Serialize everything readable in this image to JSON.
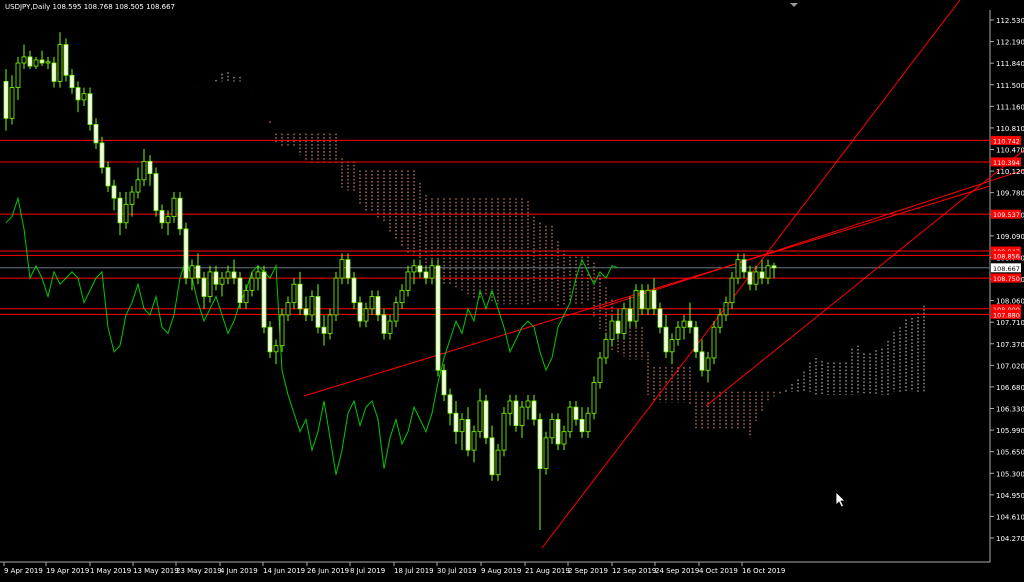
{
  "header": {
    "symbol_label": "USDJPY,Daily",
    "ohlc_label": "108.595 108.768 108.505 108.667"
  },
  "colors": {
    "background": "#000000",
    "bull_candle": "#7CFC00",
    "bear_candle": "#7CFC00",
    "candle_fill_bull": "#ffffff",
    "chikou": "#00c800",
    "kumo_bull": "#d8d8d8",
    "kumo_bear": "#ff9f80",
    "trendline": "#ff0000",
    "hline": "#ff0000",
    "axis_text": "#ffffff",
    "price_tag_bg": "#ff0000"
  },
  "chart_data": {
    "type": "candlestick",
    "title": "USDJPY,Daily",
    "ylim": [
      104.27,
      112.7
    ],
    "y_ticks": [
      "112.530",
      "112.190",
      "111.840",
      "111.500",
      "111.160",
      "110.810",
      "110.470",
      "110.120",
      "109.780",
      "109.430",
      "109.090",
      "108.740",
      "108.400",
      "108.060",
      "107.710",
      "107.370",
      "107.020",
      "106.680",
      "106.330",
      "105.990",
      "105.650",
      "105.300",
      "104.950",
      "104.610",
      "104.270"
    ],
    "x_labels": [
      "9 Apr 2019",
      "19 Apr 2019",
      "1 May 2019",
      "13 May 2019",
      "23 May 2019",
      "4 Jun 2019",
      "14 Jun 2019",
      "26 Jun 2019",
      "8 Jul 2019",
      "18 Jul 2019",
      "30 Jul 2019",
      "9 Aug 2019",
      "21 Aug 2019",
      "2 Sep 2019",
      "12 Sep 2019",
      "24 Sep 2019",
      "4 Oct 2019",
      "16 Oct 2019"
    ],
    "current_price": "108.667",
    "price_tags": [
      {
        "value": 110.74,
        "label": "110.742"
      },
      {
        "value": 110.39,
        "label": "110.394"
      },
      {
        "value": 109.54,
        "label": "109.537"
      },
      {
        "value": 108.94,
        "label": "108.947"
      },
      {
        "value": 108.87,
        "label": "108.856"
      },
      {
        "value": 108.5,
        "label": "108.750"
      },
      {
        "value": 108.0,
        "label": "108.000"
      },
      {
        "value": 107.91,
        "label": "107.880"
      }
    ],
    "ohlc": [
      [
        111.7,
        111.9,
        110.9,
        111.1
      ],
      [
        111.1,
        111.8,
        111.0,
        111.6
      ],
      [
        111.6,
        112.1,
        111.4,
        112.0
      ],
      [
        112.0,
        112.3,
        111.9,
        112.1
      ],
      [
        112.1,
        112.2,
        111.9,
        111.95
      ],
      [
        111.95,
        112.1,
        111.9,
        112.05
      ],
      [
        112.05,
        112.2,
        111.95,
        112.0
      ],
      [
        112.0,
        112.1,
        111.9,
        112.02
      ],
      [
        112.0,
        112.1,
        111.6,
        111.7
      ],
      [
        111.7,
        112.5,
        111.6,
        112.3
      ],
      [
        112.3,
        112.4,
        111.7,
        111.8
      ],
      [
        111.8,
        111.9,
        111.5,
        111.6
      ],
      [
        111.6,
        111.7,
        111.2,
        111.4
      ],
      [
        111.4,
        111.6,
        111.3,
        111.5
      ],
      [
        111.5,
        111.6,
        110.9,
        111.0
      ],
      [
        111.0,
        111.1,
        110.6,
        110.7
      ],
      [
        110.7,
        110.8,
        110.2,
        110.3
      ],
      [
        110.3,
        110.4,
        109.9,
        110.0
      ],
      [
        110.0,
        110.1,
        109.6,
        109.8
      ],
      [
        109.8,
        109.9,
        109.2,
        109.4
      ],
      [
        109.4,
        109.9,
        109.3,
        109.7
      ],
      [
        109.7,
        110.0,
        109.5,
        109.9
      ],
      [
        109.9,
        110.3,
        109.8,
        110.1
      ],
      [
        110.1,
        110.6,
        110.0,
        110.4
      ],
      [
        110.4,
        110.5,
        110.0,
        110.2
      ],
      [
        110.2,
        110.3,
        109.5,
        109.6
      ],
      [
        109.6,
        109.7,
        109.3,
        109.4
      ],
      [
        109.4,
        109.6,
        109.2,
        109.5
      ],
      [
        109.5,
        109.9,
        109.4,
        109.8
      ],
      [
        109.8,
        109.9,
        109.2,
        109.3
      ],
      [
        109.3,
        109.4,
        108.4,
        108.5
      ],
      [
        108.5,
        108.8,
        108.3,
        108.7
      ],
      [
        108.7,
        108.9,
        108.4,
        108.5
      ],
      [
        108.5,
        108.6,
        108.0,
        108.2
      ],
      [
        108.2,
        108.7,
        108.1,
        108.6
      ],
      [
        108.6,
        108.7,
        108.3,
        108.4
      ],
      [
        108.4,
        108.6,
        108.2,
        108.5
      ],
      [
        108.5,
        108.7,
        108.4,
        108.6
      ],
      [
        108.6,
        108.8,
        108.4,
        108.5
      ],
      [
        108.5,
        108.6,
        108.0,
        108.1
      ],
      [
        108.1,
        108.4,
        108.0,
        108.3
      ],
      [
        108.3,
        108.6,
        108.2,
        108.5
      ],
      [
        108.5,
        108.7,
        108.3,
        108.6
      ],
      [
        108.6,
        108.7,
        107.6,
        107.7
      ],
      [
        107.7,
        107.8,
        107.2,
        107.3
      ],
      [
        107.3,
        107.5,
        107.1,
        107.4
      ],
      [
        107.4,
        108.0,
        107.3,
        107.9
      ],
      [
        107.9,
        108.2,
        107.8,
        108.1
      ],
      [
        108.1,
        108.5,
        108.0,
        108.4
      ],
      [
        108.4,
        108.6,
        107.9,
        108.0
      ],
      [
        108.0,
        108.2,
        107.8,
        107.9
      ],
      [
        107.9,
        108.3,
        107.8,
        108.2
      ],
      [
        108.2,
        108.4,
        107.6,
        107.7
      ],
      [
        107.7,
        107.9,
        107.4,
        107.6
      ],
      [
        107.6,
        108.0,
        107.5,
        107.9
      ],
      [
        107.9,
        108.6,
        107.8,
        108.5
      ],
      [
        108.5,
        108.9,
        108.4,
        108.8
      ],
      [
        108.8,
        108.9,
        108.4,
        108.5
      ],
      [
        108.5,
        108.6,
        108.0,
        108.1
      ],
      [
        108.1,
        108.2,
        107.7,
        107.8
      ],
      [
        107.8,
        108.1,
        107.7,
        108.0
      ],
      [
        108.0,
        108.3,
        107.9,
        108.2
      ],
      [
        108.2,
        108.3,
        107.8,
        107.9
      ],
      [
        107.9,
        108.0,
        107.5,
        107.6
      ],
      [
        107.6,
        107.9,
        107.5,
        107.8
      ],
      [
        107.8,
        108.2,
        107.7,
        108.1
      ],
      [
        108.1,
        108.4,
        108.0,
        108.3
      ],
      [
        108.3,
        108.7,
        108.2,
        108.6
      ],
      [
        108.6,
        108.8,
        108.4,
        108.7
      ],
      [
        108.7,
        108.8,
        108.5,
        108.6
      ],
      [
        108.6,
        108.7,
        108.4,
        108.5
      ],
      [
        108.5,
        108.8,
        108.4,
        108.7
      ],
      [
        108.7,
        108.8,
        106.9,
        107.0
      ],
      [
        107.0,
        107.1,
        106.5,
        106.6
      ],
      [
        106.6,
        106.7,
        106.1,
        106.3
      ],
      [
        106.3,
        106.5,
        105.8,
        106.0
      ],
      [
        106.0,
        106.3,
        105.7,
        106.2
      ],
      [
        106.2,
        106.4,
        105.6,
        105.7
      ],
      [
        105.7,
        106.1,
        105.5,
        106.0
      ],
      [
        106.0,
        106.7,
        105.9,
        106.5
      ],
      [
        106.5,
        106.6,
        105.8,
        105.9
      ],
      [
        105.9,
        106.1,
        105.2,
        105.3
      ],
      [
        105.3,
        105.8,
        105.2,
        105.7
      ],
      [
        105.7,
        106.4,
        105.6,
        106.3
      ],
      [
        106.3,
        106.6,
        106.1,
        106.5
      ],
      [
        106.5,
        106.6,
        106.0,
        106.1
      ],
      [
        106.1,
        106.5,
        105.9,
        106.4
      ],
      [
        106.4,
        106.6,
        106.2,
        106.5
      ],
      [
        106.5,
        106.6,
        106.1,
        106.2
      ],
      [
        106.2,
        106.3,
        104.4,
        105.4
      ],
      [
        105.4,
        106.0,
        105.3,
        105.9
      ],
      [
        105.9,
        106.3,
        105.8,
        106.2
      ],
      [
        106.2,
        106.3,
        105.7,
        105.8
      ],
      [
        105.8,
        106.1,
        105.7,
        106.0
      ],
      [
        106.0,
        106.5,
        105.9,
        106.4
      ],
      [
        106.4,
        106.5,
        106.1,
        106.2
      ],
      [
        106.2,
        106.4,
        105.9,
        106.0
      ],
      [
        106.0,
        106.4,
        105.9,
        106.3
      ],
      [
        106.3,
        106.9,
        106.2,
        106.8
      ],
      [
        106.8,
        107.3,
        106.7,
        107.2
      ],
      [
        107.2,
        107.6,
        107.1,
        107.5
      ],
      [
        107.5,
        107.9,
        107.4,
        107.8
      ],
      [
        107.8,
        108.0,
        107.5,
        107.6
      ],
      [
        107.6,
        108.1,
        107.5,
        108.0
      ],
      [
        108.0,
        108.2,
        107.7,
        107.8
      ],
      [
        107.8,
        108.4,
        107.7,
        108.3
      ],
      [
        108.3,
        108.4,
        107.9,
        108.0
      ],
      [
        108.0,
        108.4,
        107.9,
        108.3
      ],
      [
        108.3,
        108.5,
        107.9,
        108.0
      ],
      [
        108.0,
        108.1,
        107.6,
        107.7
      ],
      [
        107.7,
        107.9,
        107.2,
        107.3
      ],
      [
        107.3,
        107.6,
        107.1,
        107.5
      ],
      [
        107.5,
        107.8,
        107.4,
        107.7
      ],
      [
        107.7,
        107.9,
        107.5,
        107.8
      ],
      [
        107.8,
        108.1,
        107.6,
        107.7
      ],
      [
        107.7,
        107.8,
        107.2,
        107.3
      ],
      [
        107.3,
        107.5,
        106.9,
        107.0
      ],
      [
        107.0,
        107.3,
        106.8,
        107.2
      ],
      [
        107.2,
        107.8,
        107.1,
        107.7
      ],
      [
        107.7,
        108.0,
        107.6,
        107.9
      ],
      [
        107.9,
        108.2,
        107.8,
        108.1
      ],
      [
        108.1,
        108.6,
        108.0,
        108.5
      ],
      [
        108.5,
        108.9,
        108.4,
        108.8
      ],
      [
        108.8,
        108.9,
        108.5,
        108.6
      ],
      [
        108.6,
        108.7,
        108.3,
        108.4
      ],
      [
        108.4,
        108.7,
        108.3,
        108.6
      ],
      [
        108.6,
        108.8,
        108.4,
        108.5
      ],
      [
        108.5,
        108.8,
        108.4,
        108.7
      ],
      [
        108.7,
        108.75,
        108.5,
        108.667
      ]
    ]
  }
}
